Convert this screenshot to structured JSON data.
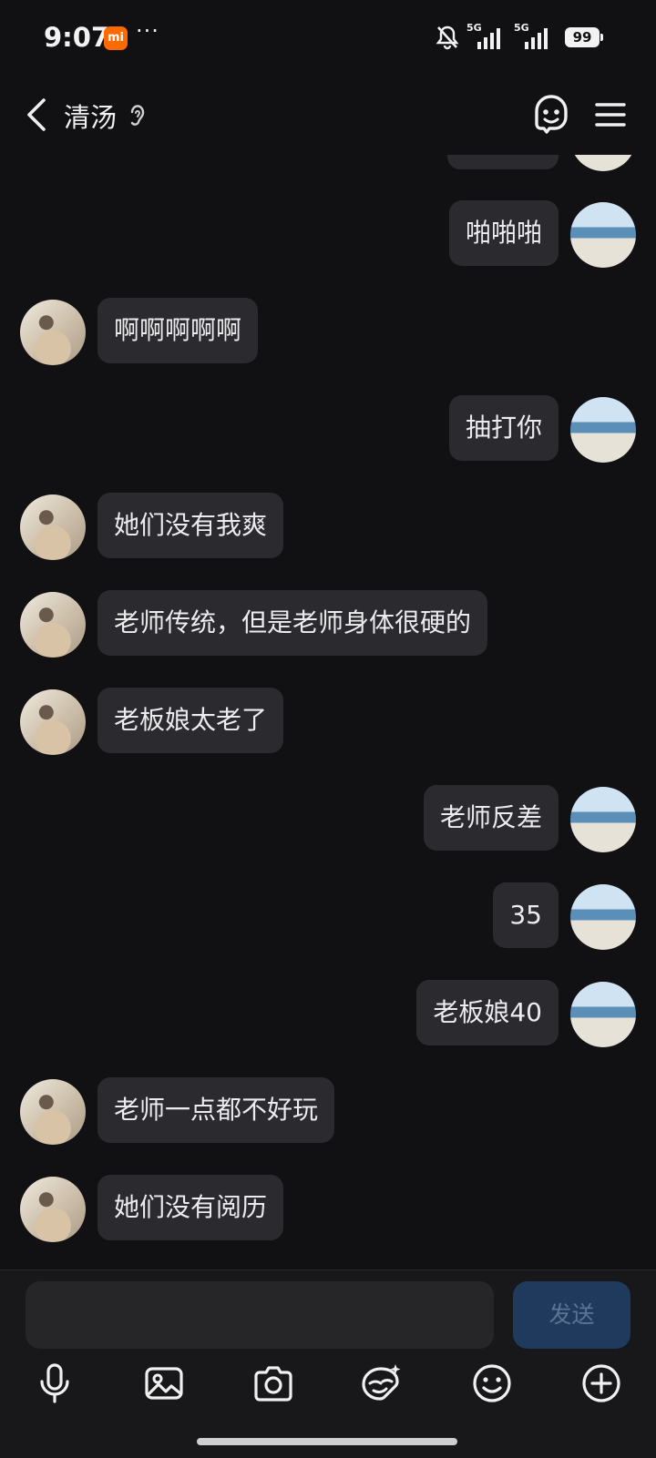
{
  "status_bar": {
    "time": "9:07",
    "mi_badge": "mi",
    "dots": "···",
    "signal1": "5G",
    "signal2": "5G",
    "battery": "99"
  },
  "header": {
    "title": "清汤",
    "icons": [
      "back-arrow-icon",
      "ear-icon",
      "emoji-ghost-icon",
      "menu-icon"
    ]
  },
  "messages": [
    {
      "side": "right",
      "text": "啪啪啪"
    },
    {
      "side": "left",
      "text": "啊啊啊啊啊"
    },
    {
      "side": "right",
      "text": "抽打你"
    },
    {
      "side": "left",
      "text": "她们没有我爽"
    },
    {
      "side": "left",
      "text": "老师传统，但是老师身体很硬的"
    },
    {
      "side": "left",
      "text": "老板娘太老了"
    },
    {
      "side": "right",
      "text": "老师反差"
    },
    {
      "side": "right",
      "text": "35"
    },
    {
      "side": "right",
      "text": "老板娘40"
    },
    {
      "side": "left",
      "text": "老师一点都不好玩"
    },
    {
      "side": "left",
      "text": "她们没有阅历"
    }
  ],
  "composer": {
    "input_value": "",
    "input_placeholder": "",
    "send_label": "发送"
  },
  "toolbar": {
    "items": [
      "microphone-icon",
      "image-icon",
      "camera-icon",
      "sticker-icon",
      "emoji-icon",
      "add-icon"
    ]
  },
  "colors": {
    "background": "#111114",
    "bubble": "#2b2b2f",
    "send_button": "#1f3a5c",
    "send_text": "#5a7494"
  }
}
